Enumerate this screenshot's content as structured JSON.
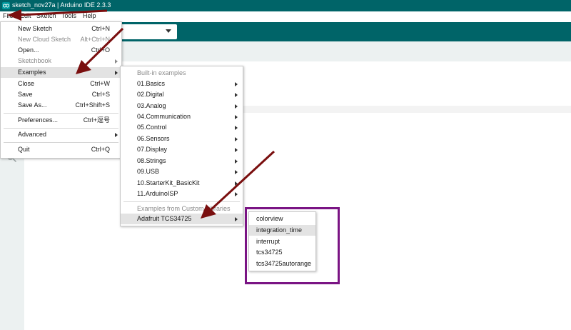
{
  "window": {
    "title": "sketch_nov27a | Arduino IDE 2.3.3"
  },
  "menubar": {
    "items": [
      {
        "label": "File"
      },
      {
        "label": "Edit"
      },
      {
        "label": "Sketch"
      },
      {
        "label": "Tools"
      },
      {
        "label": "Help"
      }
    ]
  },
  "file_menu": {
    "items": [
      {
        "label": "New Sketch",
        "shortcut": "Ctrl+N"
      },
      {
        "label": "New Cloud Sketch",
        "shortcut": "Alt+Ctrl+N"
      },
      {
        "label": "Open...",
        "shortcut": "Ctrl+O"
      },
      {
        "label": "Sketchbook",
        "shortcut": ""
      },
      {
        "label": "Examples",
        "shortcut": ""
      },
      {
        "label": "Close",
        "shortcut": "Ctrl+W"
      },
      {
        "label": "Save",
        "shortcut": "Ctrl+S"
      },
      {
        "label": "Save As...",
        "shortcut": "Ctrl+Shift+S"
      },
      {
        "label": "Preferences...",
        "shortcut": "Ctrl+逗号"
      },
      {
        "label": "Advanced",
        "shortcut": ""
      },
      {
        "label": "Quit",
        "shortcut": "Ctrl+Q"
      }
    ]
  },
  "examples_menu": {
    "builtin_header": "Built-in examples",
    "items": [
      {
        "label": "01.Basics"
      },
      {
        "label": "02.Digital"
      },
      {
        "label": "03.Analog"
      },
      {
        "label": "04.Communication"
      },
      {
        "label": "05.Control"
      },
      {
        "label": "06.Sensors"
      },
      {
        "label": "07.Display"
      },
      {
        "label": "08.Strings"
      },
      {
        "label": "09.USB"
      },
      {
        "label": "10.StarterKit_BasicKit"
      },
      {
        "label": "11.ArduinoISP"
      }
    ],
    "custom_header": "Examples from Custom Libraries",
    "custom_items": [
      {
        "label": "Adafruit TCS34725"
      }
    ]
  },
  "tcs_menu": {
    "items": [
      {
        "label": "colorview"
      },
      {
        "label": "integration_time"
      },
      {
        "label": "interrupt"
      },
      {
        "label": "tcs34725"
      },
      {
        "label": "tcs34725autorange"
      }
    ]
  },
  "colors": {
    "teal": "#006468",
    "annotation_arrow": "#7a0f0f",
    "annotation_box": "#7a1484"
  }
}
